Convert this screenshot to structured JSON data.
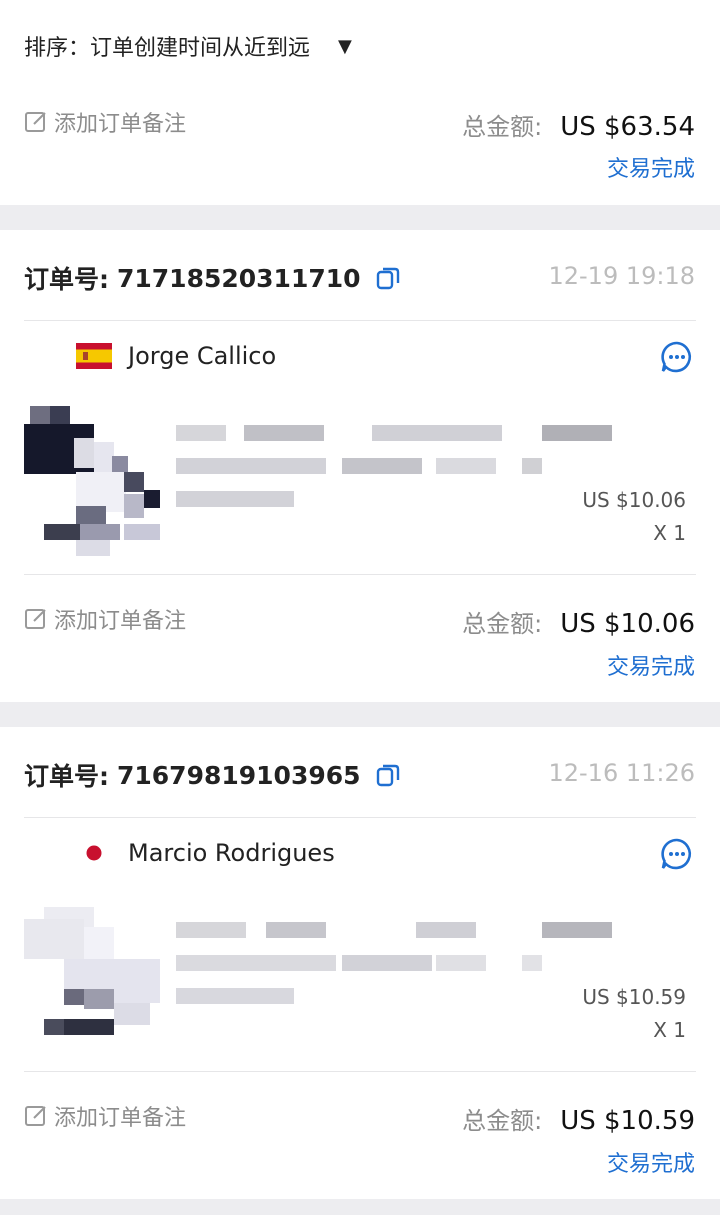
{
  "sort": {
    "label": "排序：订单创建时间从近到远",
    "arrow": "▼"
  },
  "note_label": "添加订单备注",
  "total_label": "总金额:",
  "first_summary": {
    "total": "US $63.54",
    "status": "交易完成"
  },
  "orders": [
    {
      "order_label": "订单号:",
      "number": "71718520311710",
      "time": "12-19 19:18",
      "seller": "Jorge Callico",
      "flag": "spain-flag-icon",
      "price": "US $10.06",
      "qty": "X 1",
      "total": "US $10.06",
      "status": "交易完成"
    },
    {
      "order_label": "订单号:",
      "number": "71679819103965",
      "time": "12-16 11:26",
      "seller": "Marcio Rodrigues",
      "flag": "red-dot-flag-icon",
      "price": "US $10.59",
      "qty": "X 1",
      "total": "US $10.59",
      "status": "交易完成"
    }
  ],
  "colors": {
    "accent": "#1f6fd1",
    "muted": "#8c8c8c",
    "background": "#ededf0"
  }
}
